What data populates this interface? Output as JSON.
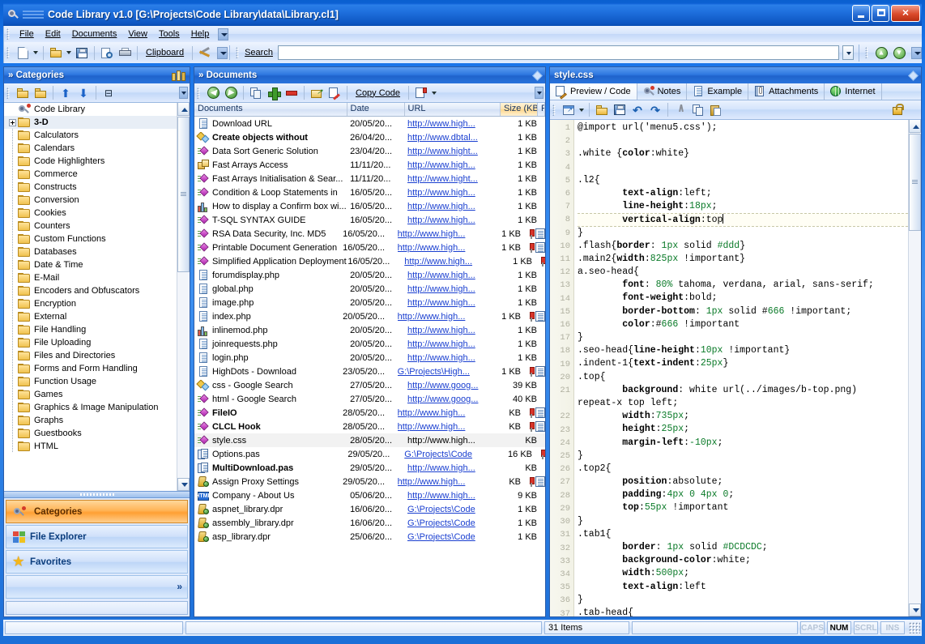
{
  "window": {
    "title": "Code Library v1.0 [G:\\Projects\\Code Library\\data\\Library.cl1]",
    "icon": "magnifier-icon",
    "minimize": "–",
    "maximize": "□",
    "close": "✕"
  },
  "menubar": {
    "items": [
      {
        "label": "File"
      },
      {
        "label": "Edit"
      },
      {
        "label": "Documents"
      },
      {
        "label": "View"
      },
      {
        "label": "Tools"
      },
      {
        "label": "Help"
      }
    ],
    "overflow": "chevron-down-icon"
  },
  "toolbar": {
    "new_label": "new-document-icon",
    "open_label": "open-folder-icon",
    "save_label": "save-icon",
    "preview_label": "print-preview-icon",
    "print_label": "print-icon",
    "clipboard_label": "Clipboard",
    "tools_label": "tools-icon",
    "search_label": "Search",
    "search_value": "",
    "search_placeholder": "",
    "nav_up": "up-icon",
    "nav_down": "down-icon"
  },
  "categories": {
    "title": "» Categories",
    "header_icon": "books-icon",
    "toolbar": [
      {
        "name": "new-category-icon"
      },
      {
        "name": "delete-category-icon"
      },
      {
        "name": "move-up-icon"
      },
      {
        "name": "move-down-icon"
      },
      {
        "name": "sort-icon"
      }
    ],
    "root": "Code Library",
    "items": [
      {
        "label": "3-D",
        "expandable": true,
        "selected": true,
        "bold": true
      },
      {
        "label": "Calculators"
      },
      {
        "label": "Calendars"
      },
      {
        "label": "Code Highlighters"
      },
      {
        "label": "Commerce"
      },
      {
        "label": "Constructs"
      },
      {
        "label": "Conversion"
      },
      {
        "label": "Cookies"
      },
      {
        "label": "Counters"
      },
      {
        "label": "Custom Functions"
      },
      {
        "label": "Databases"
      },
      {
        "label": "Date & Time"
      },
      {
        "label": "E-Mail"
      },
      {
        "label": "Encoders and Obfuscators"
      },
      {
        "label": "Encryption"
      },
      {
        "label": "External"
      },
      {
        "label": "File Handling"
      },
      {
        "label": "File Uploading"
      },
      {
        "label": "Files and Directories"
      },
      {
        "label": "Forms and Form Handling"
      },
      {
        "label": "Function Usage"
      },
      {
        "label": "Games"
      },
      {
        "label": "Graphics & Image Manipulation"
      },
      {
        "label": "Graphs"
      },
      {
        "label": "Guestbooks"
      },
      {
        "label": "HTML"
      }
    ],
    "navbar": [
      {
        "label": "Categories",
        "icon": "magnifier-book-icon",
        "active": true
      },
      {
        "label": "File Explorer",
        "icon": "windows-icon",
        "active": false
      },
      {
        "label": "Favorites",
        "icon": "star-icon",
        "active": false
      }
    ],
    "navbar_overflow": "»"
  },
  "documents": {
    "title": "» Documents",
    "header_icon": "diamond-icon",
    "toolbar": {
      "back": "back-icon",
      "forward": "forward-icon",
      "duplicate": "duplicate-icon",
      "add": "add-icon",
      "remove": "remove-icon",
      "move": "move-icon",
      "edit": "edit-icon",
      "copy_code": "Copy Code",
      "report": "report-icon"
    },
    "columns": [
      "Documents",
      "Date",
      "URL",
      "Size (KB)",
      "Flag"
    ],
    "sorted_column": "Size (KB)",
    "rows": [
      {
        "icon": "doc",
        "name": "Download URL",
        "date": "20/05/20...",
        "url": "http://www.high...",
        "link": true,
        "size": "1 KB",
        "flags": []
      },
      {
        "icon": "star",
        "name": "Create objects without",
        "date": "26/04/20...",
        "url": "http://www.dbtal...",
        "link": true,
        "size": "1 KB",
        "bold": true,
        "flags": []
      },
      {
        "icon": "dia",
        "name": "Data Sort Generic Solution",
        "date": "23/04/20...",
        "url": "http://www.hight...",
        "link": true,
        "size": "1 KB",
        "flags": []
      },
      {
        "icon": "fast",
        "name": "Fast Arrays Access",
        "date": "11/11/20...",
        "url": "http://www.high...",
        "link": true,
        "size": "1 KB",
        "flags": []
      },
      {
        "icon": "dia",
        "name": "Fast Arrays Initialisation & Sear...",
        "date": "11/11/20...",
        "url": "http://www.hight...",
        "link": true,
        "size": "1 KB",
        "flags": []
      },
      {
        "icon": "dia",
        "name": "Condition & Loop Statements in",
        "date": "16/05/20...",
        "url": "http://www.high...",
        "link": true,
        "size": "1 KB",
        "flags": []
      },
      {
        "icon": "chart",
        "name": "How to display a Confirm box wi...",
        "date": "16/05/20...",
        "url": "http://www.high...",
        "link": true,
        "size": "1 KB",
        "flags": []
      },
      {
        "icon": "dia",
        "name": "T-SQL SYNTAX GUIDE",
        "date": "16/05/20...",
        "url": "http://www.high...",
        "link": true,
        "size": "1 KB",
        "flags": []
      },
      {
        "icon": "dia",
        "name": "RSA Data Security, Inc. MD5",
        "date": "16/05/20...",
        "url": "http://www.high...",
        "link": true,
        "size": "1 KB",
        "flags": [
          "flag",
          "attach"
        ]
      },
      {
        "icon": "dia",
        "name": "Printable Document Generation",
        "date": "16/05/20...",
        "url": "http://www.high...",
        "link": true,
        "size": "1 KB",
        "flags": [
          "flag",
          "attach"
        ]
      },
      {
        "icon": "dia",
        "name": "Simplified Application Deployment",
        "date": "16/05/20...",
        "url": "http://www.high...",
        "link": true,
        "size": "1 KB",
        "flags": [
          "flag"
        ]
      },
      {
        "icon": "doc",
        "name": "forumdisplay.php",
        "date": "20/05/20...",
        "url": "http://www.high...",
        "link": true,
        "size": "1 KB",
        "flags": []
      },
      {
        "icon": "doc",
        "name": "global.php",
        "date": "20/05/20...",
        "url": "http://www.high...",
        "link": true,
        "size": "1 KB",
        "flags": []
      },
      {
        "icon": "doc",
        "name": "image.php",
        "date": "20/05/20...",
        "url": "http://www.high...",
        "link": true,
        "size": "1 KB",
        "flags": []
      },
      {
        "icon": "doc",
        "name": "index.php",
        "date": "20/05/20...",
        "url": "http://www.high...",
        "link": true,
        "size": "1 KB",
        "flags": [
          "flag",
          "attach"
        ]
      },
      {
        "icon": "chart",
        "name": "inlinemod.php",
        "date": "20/05/20...",
        "url": "http://www.high...",
        "link": true,
        "size": "1 KB",
        "flags": []
      },
      {
        "icon": "doc",
        "name": "joinrequests.php",
        "date": "20/05/20...",
        "url": "http://www.high...",
        "link": true,
        "size": "1 KB",
        "flags": []
      },
      {
        "icon": "doc",
        "name": "login.php",
        "date": "20/05/20...",
        "url": "http://www.high...",
        "link": true,
        "size": "1 KB",
        "flags": []
      },
      {
        "icon": "doc",
        "name": "HighDots - Download",
        "date": "23/05/20...",
        "url": "G:\\Projects\\High...",
        "link": true,
        "size": "1 KB",
        "flags": [
          "flag",
          "attach"
        ]
      },
      {
        "icon": "star",
        "name": "css - Google Search",
        "date": "27/05/20...",
        "url": "http://www.goog...",
        "link": true,
        "size": "39 KB",
        "flags": []
      },
      {
        "icon": "dia",
        "name": "html - Google Search",
        "date": "27/05/20...",
        "url": "http://www.goog...",
        "link": true,
        "size": "40 KB",
        "flags": []
      },
      {
        "icon": "dia",
        "name": "FileIO",
        "date": "28/05/20...",
        "url": "http://www.high...",
        "link": true,
        "size": "KB",
        "bold": true,
        "flags": [
          "flag",
          "attach"
        ]
      },
      {
        "icon": "dia",
        "name": "CLCL Hook",
        "date": "28/05/20...",
        "url": "http://www.high...",
        "link": true,
        "size": "KB",
        "bold": true,
        "flags": [
          "flag",
          "attach"
        ]
      },
      {
        "icon": "dia",
        "name": "style.css",
        "date": "28/05/20...",
        "url": "http://www.high...",
        "link": false,
        "size": "KB",
        "selected": true,
        "flags": []
      },
      {
        "icon": "pas",
        "name": "Options.pas",
        "date": "29/05/20...",
        "url": "G:\\Projects\\Code",
        "link": true,
        "size": "16 KB",
        "flags": [
          "flag"
        ]
      },
      {
        "icon": "pas",
        "name": "MultiDownload.pas",
        "date": "29/05/20...",
        "url": "http://www.high...",
        "link": true,
        "size": "KB",
        "bold": true,
        "flags": []
      },
      {
        "icon": "dpr",
        "name": "Assign Proxy Settings",
        "date": "29/05/20...",
        "url": "http://www.high...",
        "link": true,
        "size": "KB",
        "flags": [
          "flag",
          "attach"
        ]
      },
      {
        "icon": "html",
        "name": "Company - About Us",
        "date": "05/06/20...",
        "url": "http://www.high...",
        "link": true,
        "size": "9 KB",
        "flags": []
      },
      {
        "icon": "dpr",
        "name": "aspnet_library.dpr",
        "date": "16/06/20...",
        "url": "G:\\Projects\\Code",
        "link": true,
        "size": "1 KB",
        "flags": []
      },
      {
        "icon": "dpr",
        "name": "assembly_library.dpr",
        "date": "16/06/20...",
        "url": "G:\\Projects\\Code",
        "link": true,
        "size": "1 KB",
        "flags": []
      },
      {
        "icon": "dpr",
        "name": "asp_library.dpr",
        "date": "25/06/20...",
        "url": "G:\\Projects\\Code",
        "link": true,
        "size": "1 KB",
        "flags": []
      }
    ]
  },
  "code_panel": {
    "title": "style.css",
    "header_icon": "diamond-icon",
    "tabs": [
      {
        "label": "Preview / Code",
        "icon": "edit-doc-icon",
        "active": true
      },
      {
        "label": "Notes",
        "icon": "magnifier-book-icon",
        "active": false
      },
      {
        "label": "Example",
        "icon": "doc-icon",
        "active": false
      },
      {
        "label": "Attachments",
        "icon": "attachments-icon",
        "active": false
      },
      {
        "label": "Internet",
        "icon": "globe-icon",
        "active": false
      }
    ],
    "toolbar": {
      "open_external": "open-external-icon",
      "open_file": "open-folder-icon",
      "save": "save-icon",
      "undo": "undo-icon",
      "redo": "redo-icon",
      "cut": "cut-icon",
      "copy": "copy-icon",
      "paste": "paste-icon",
      "lock": "lock-icon"
    },
    "cursor_line": 8,
    "lines": [
      {
        "n": 1,
        "text": "@import url('menu5.css');"
      },
      {
        "n": 2,
        "text": ""
      },
      {
        "n": 3,
        "text": ".white {color:white}"
      },
      {
        "n": 4,
        "text": ""
      },
      {
        "n": 5,
        "text": ".l2{"
      },
      {
        "n": 6,
        "text": "        text-align:left;"
      },
      {
        "n": 7,
        "text": "        line-height:18px;"
      },
      {
        "n": 8,
        "text": "        vertical-align:top"
      },
      {
        "n": 9,
        "text": "}"
      },
      {
        "n": 10,
        "text": ".flash{border: 1px solid #ddd}"
      },
      {
        "n": 11,
        "text": ".main2{width:825px !important}"
      },
      {
        "n": 12,
        "text": "a.seo-head{"
      },
      {
        "n": 13,
        "text": "        font: 80% tahoma, verdana, arial, sans-serif;"
      },
      {
        "n": 14,
        "text": "        font-weight:bold;"
      },
      {
        "n": 15,
        "text": "        border-bottom: 1px solid #666 !important;"
      },
      {
        "n": 16,
        "text": "        color:#666 !important"
      },
      {
        "n": 17,
        "text": "}"
      },
      {
        "n": 18,
        "text": ".seo-head{line-height:10px !important}"
      },
      {
        "n": 19,
        "text": ".indent-1{text-indent:25px}"
      },
      {
        "n": 20,
        "text": ".top{"
      },
      {
        "n": 21,
        "text": "        background: white url(../images/b-top.png)\nrepeat-x top left;"
      },
      {
        "n": 22,
        "text": "        width:735px;"
      },
      {
        "n": 23,
        "text": "        height:25px;"
      },
      {
        "n": 24,
        "text": "        margin-left:-10px;"
      },
      {
        "n": 25,
        "text": "}"
      },
      {
        "n": 26,
        "text": ".top2{"
      },
      {
        "n": 27,
        "text": "        position:absolute;"
      },
      {
        "n": 28,
        "text": "        padding:4px 0 4px 0;"
      },
      {
        "n": 29,
        "text": "        top:55px !important"
      },
      {
        "n": 30,
        "text": "}"
      },
      {
        "n": 31,
        "text": ".tab1{"
      },
      {
        "n": 32,
        "text": "        border: 1px solid #DCDCDC;"
      },
      {
        "n": 33,
        "text": "        background-color:white;"
      },
      {
        "n": 34,
        "text": "        width:500px;"
      },
      {
        "n": 35,
        "text": "        text-align:left"
      },
      {
        "n": 36,
        "text": "}"
      },
      {
        "n": 37,
        "text": ".tab-head{"
      }
    ]
  },
  "statusbar": {
    "item_count": "31 Items",
    "message": "",
    "indicators": [
      {
        "label": "CAPS",
        "on": false
      },
      {
        "label": "NUM",
        "on": true
      },
      {
        "label": "SCRL",
        "on": false
      },
      {
        "label": "INS",
        "on": false
      }
    ]
  }
}
